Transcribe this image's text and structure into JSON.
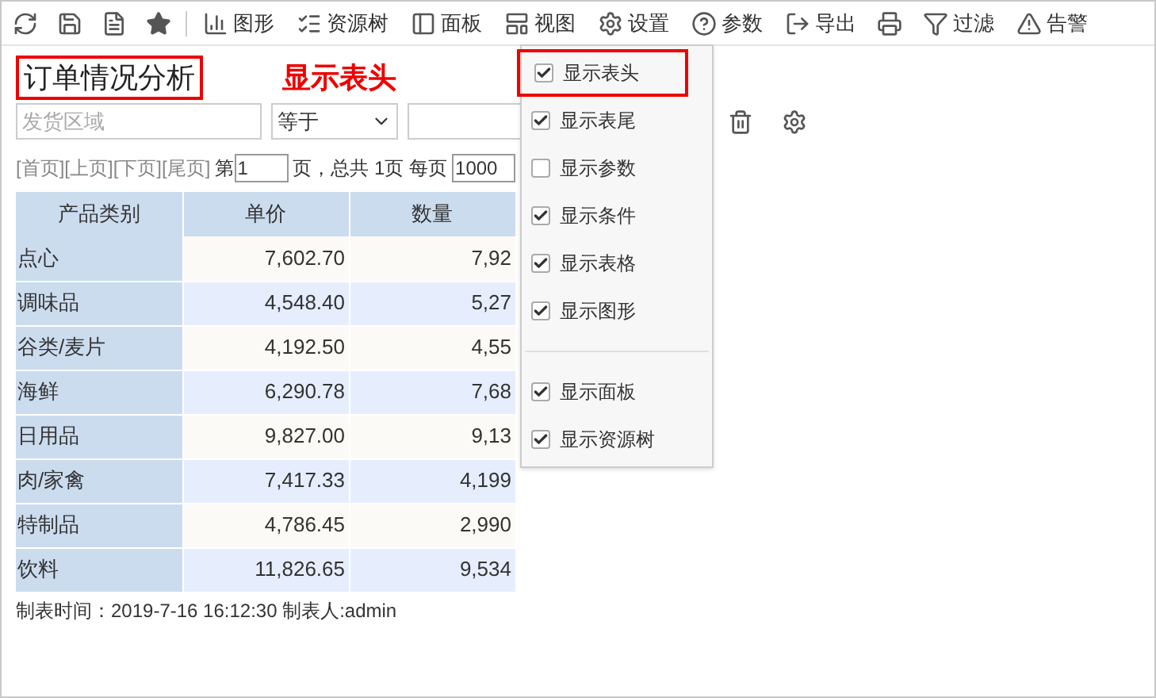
{
  "toolbar": [
    {
      "kind": "refresh"
    },
    {
      "kind": "save"
    },
    {
      "kind": "saveas"
    },
    {
      "kind": "star"
    },
    {
      "kind": "divider"
    },
    {
      "kind": "chart",
      "label": "图形"
    },
    {
      "kind": "tree",
      "label": "资源树"
    },
    {
      "kind": "panel",
      "label": "面板"
    },
    {
      "kind": "view",
      "label": "视图"
    },
    {
      "kind": "settings",
      "label": "设置"
    },
    {
      "kind": "help",
      "label": "参数"
    },
    {
      "kind": "export",
      "label": "导出"
    },
    {
      "kind": "print"
    },
    {
      "kind": "filter",
      "label": "过滤"
    },
    {
      "kind": "alert",
      "label": "告警"
    }
  ],
  "report_title": "订单情况分析",
  "annotation": "显示表头",
  "filter": {
    "field_placeholder": "发货区域",
    "operator": "等于"
  },
  "pager": {
    "links": [
      "[首页]",
      "[上页]",
      "[下页]",
      "[尾页]"
    ],
    "page_prefix": "第",
    "page": "1",
    "page_suffix": "页，总共 1页 每页",
    "per_page": "1000"
  },
  "table": {
    "columns": [
      "产品类别",
      "单价",
      "数量"
    ],
    "rows": [
      [
        "点心",
        "7,602.70",
        "7,92"
      ],
      [
        "调味品",
        "4,548.40",
        "5,27"
      ],
      [
        "谷类/麦片",
        "4,192.50",
        "4,55"
      ],
      [
        "海鲜",
        "6,290.78",
        "7,68"
      ],
      [
        "日用品",
        "9,827.00",
        "9,13"
      ],
      [
        "肉/家禽",
        "7,417.33",
        "4,199"
      ],
      [
        "特制品",
        "4,786.45",
        "2,990"
      ],
      [
        "饮料",
        "11,826.65",
        "9,534"
      ]
    ]
  },
  "footer": "制表时间：2019-7-16 16:12:30 制表人:admin",
  "view_menu": {
    "items": [
      {
        "label": "显示表头",
        "checked": true,
        "highlighted": true
      },
      {
        "label": "显示表尾",
        "checked": true,
        "highlighted": false
      },
      {
        "label": "显示参数",
        "checked": false,
        "highlighted": false
      },
      {
        "label": "显示条件",
        "checked": true,
        "highlighted": false
      },
      {
        "label": "显示表格",
        "checked": true,
        "highlighted": false
      },
      {
        "label": "显示图形",
        "checked": true,
        "highlighted": false
      },
      {
        "kind": "divider"
      },
      {
        "label": "显示面板",
        "checked": true,
        "highlighted": false
      },
      {
        "label": "显示资源树",
        "checked": true,
        "highlighted": false
      }
    ]
  }
}
